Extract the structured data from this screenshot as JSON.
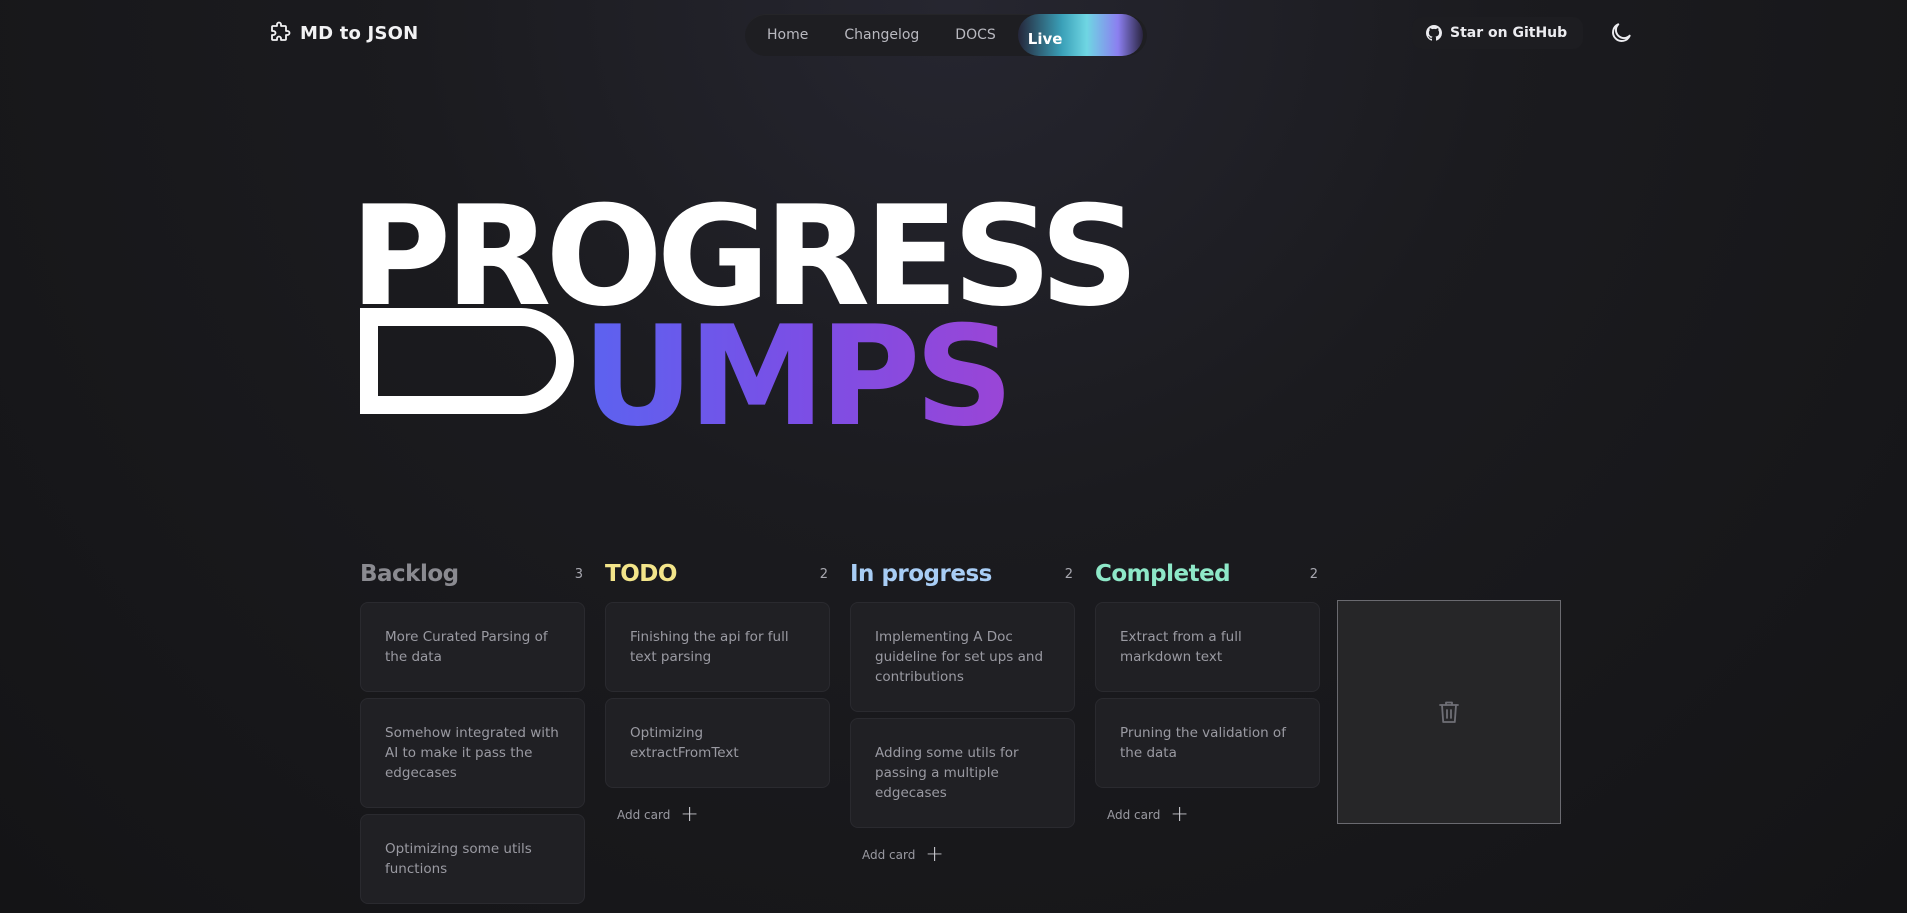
{
  "nav": {
    "brand": "MD to JSON",
    "links": [
      "Home",
      "Changelog",
      "DOCS"
    ],
    "live": "Live",
    "github": "Star on GitHub",
    "theme_icon": "moon-icon"
  },
  "hero": {
    "line1": "PROGRESS",
    "line2": "UMPS"
  },
  "colors": {
    "backlog": "#8a8a90",
    "todo": "#f3e58a",
    "in_progress": "#a8cdf5",
    "completed": "#8ee8c8",
    "hero_gradient_start": "#5b63f0",
    "hero_gradient_end": "#9a45d6"
  },
  "board": {
    "columns": [
      {
        "title": "Backlog",
        "count": "3",
        "cards": [
          "More Curated Parsing of the data",
          "Somehow integrated with AI to make it pass the edgecases",
          "Optimizing some utils functions"
        ]
      },
      {
        "title": "TODO",
        "count": "2",
        "cards": [
          "Finishing the api for full text parsing",
          "Optimizing extractFromText"
        ],
        "add_label": "Add card"
      },
      {
        "title": "In progress",
        "count": "2",
        "cards": [
          "Implementing A Doc guideline for set ups and contributions",
          "Adding some utils for passing a multiple edgecases"
        ],
        "add_label": "Add card"
      },
      {
        "title": "Completed",
        "count": "2",
        "cards": [
          "Extract from a full markdown text",
          "Pruning the validation of the data"
        ],
        "add_label": "Add card"
      }
    ],
    "trash_icon": "trash-icon"
  }
}
